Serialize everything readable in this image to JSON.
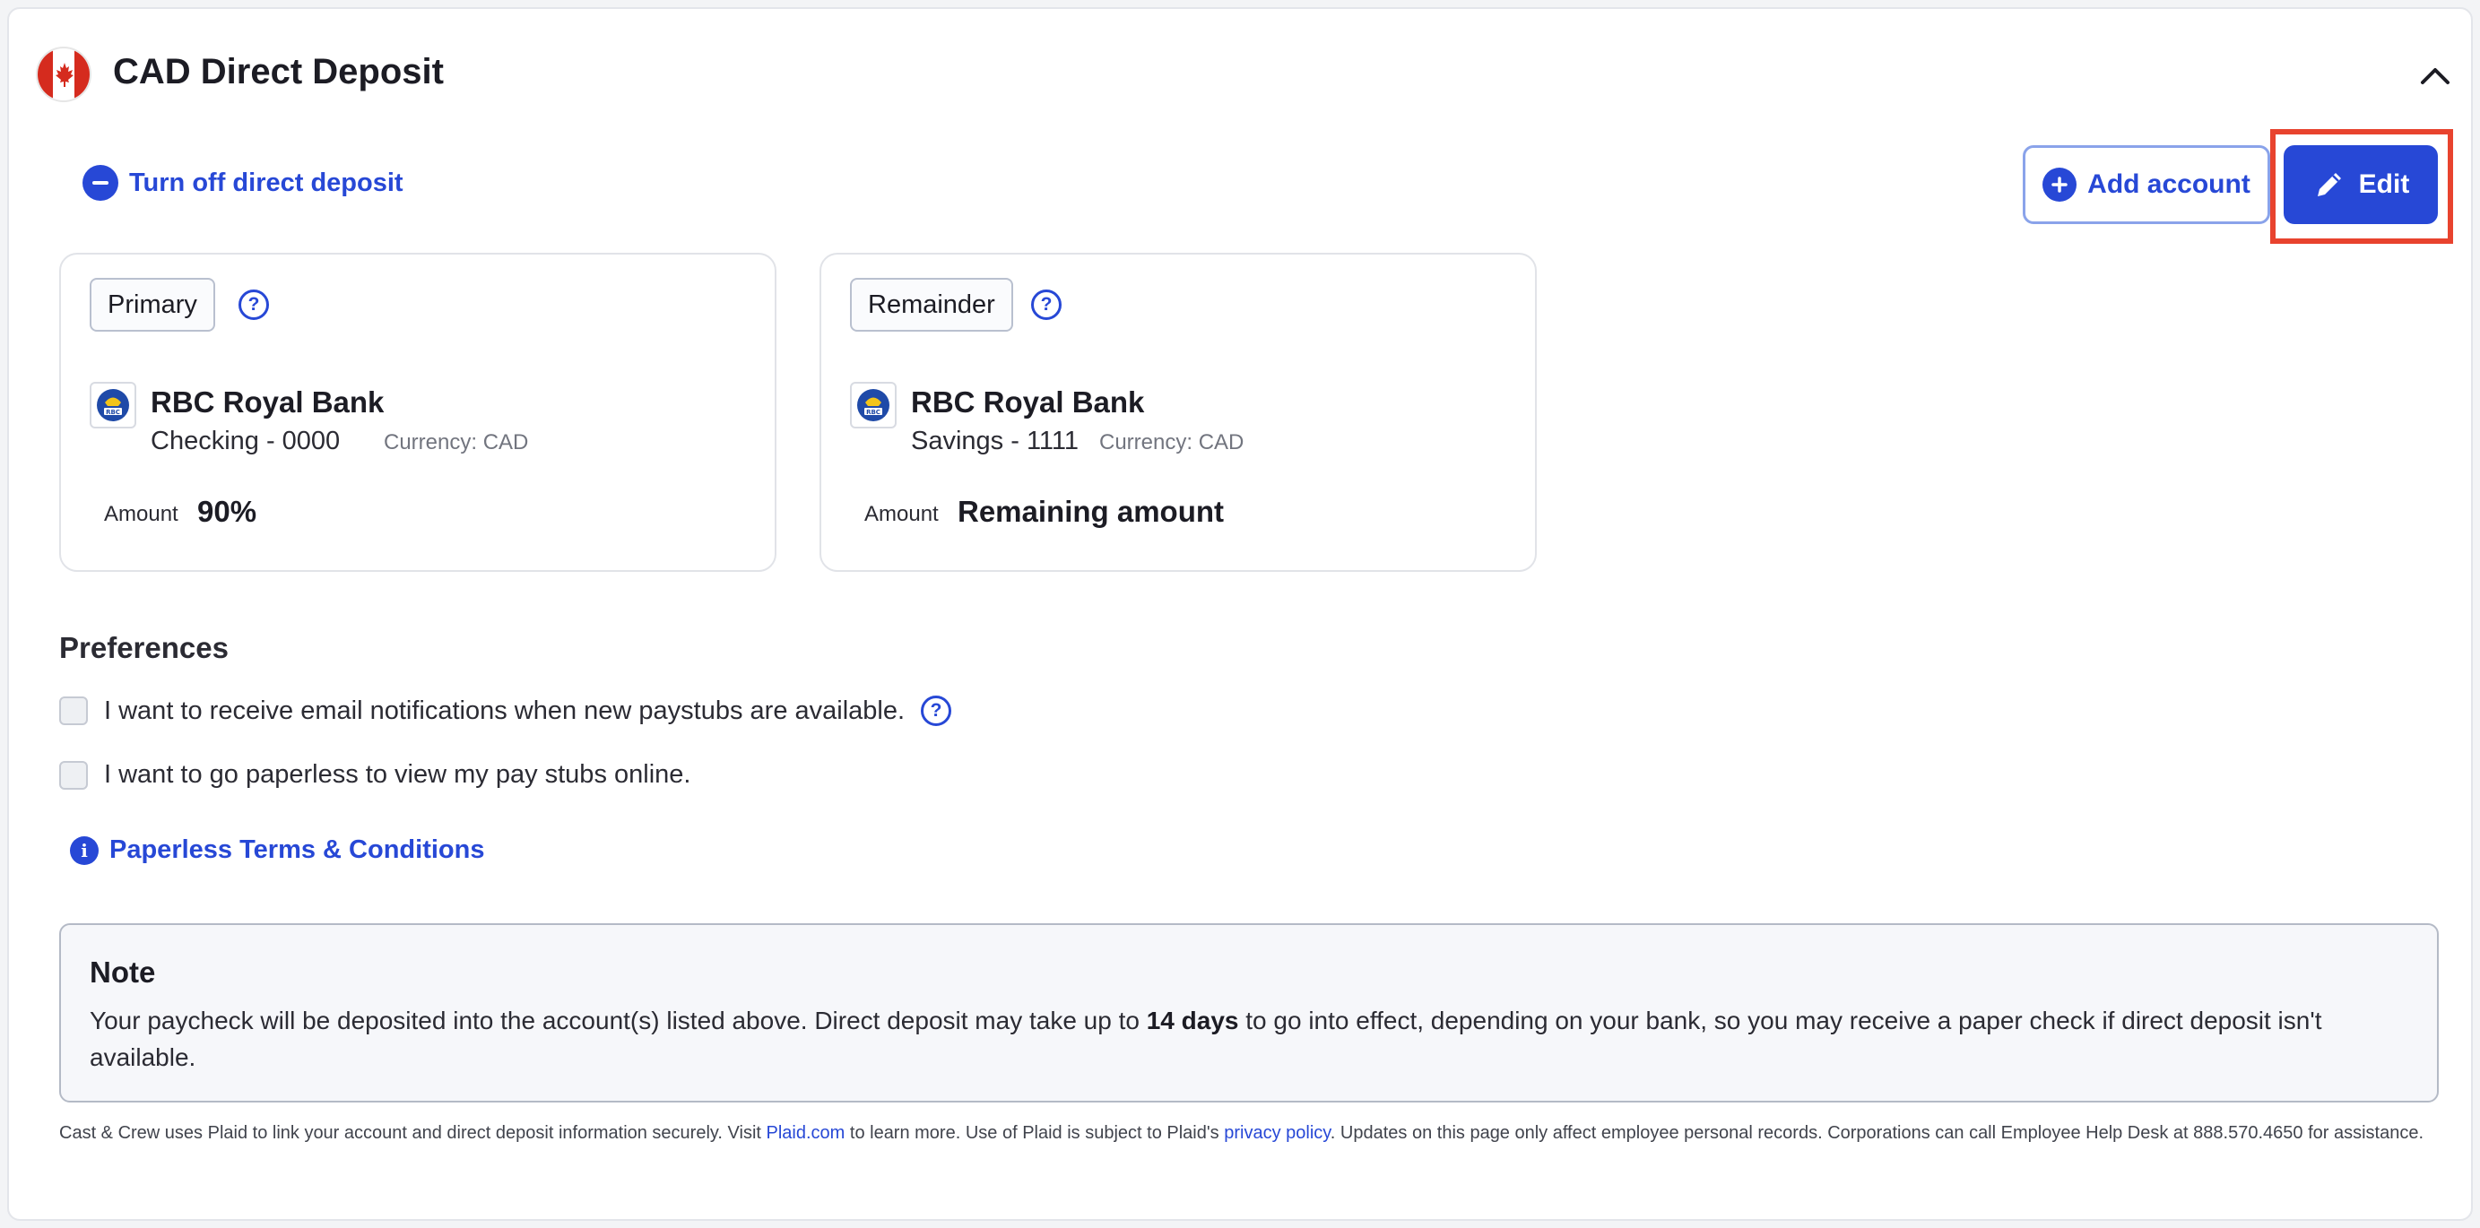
{
  "header": {
    "title": "CAD Direct Deposit",
    "flag_icon": "canada-flag-icon",
    "collapse_icon": "chevron-up-icon"
  },
  "actions": {
    "turn_off_label": "Turn off direct deposit",
    "add_account_label": "Add account",
    "edit_label": "Edit"
  },
  "accounts": [
    {
      "tag": "Primary",
      "bank_name": "RBC Royal Bank",
      "account": "Checking - 0000",
      "currency": "Currency: CAD",
      "amount_label": "Amount",
      "amount_value": "90%"
    },
    {
      "tag": "Remainder",
      "bank_name": "RBC Royal Bank",
      "account": "Savings - 1111",
      "currency": "Currency: CAD",
      "amount_label": "Amount",
      "amount_value": "Remaining amount"
    }
  ],
  "preferences": {
    "title": "Preferences",
    "email_notifications_label": "I want to receive email notifications when new paystubs are available.",
    "paperless_label": "I want to go paperless to view my pay stubs online.",
    "terms_label": "Paperless Terms & Conditions"
  },
  "note": {
    "title": "Note",
    "text_before": "Your paycheck will be deposited into the account(s) listed above. Direct deposit may take up to ",
    "text_bold": "14 days",
    "text_after": " to go into effect, depending on your bank, so you may receive a paper check if direct deposit isn't available."
  },
  "footer": {
    "part1": "Cast & Crew uses Plaid to link your account and direct deposit information securely. Visit ",
    "plaid_link": "Plaid.com",
    "part2": " to learn more. Use of Plaid is subject to Plaid's ",
    "privacy_link": "privacy policy",
    "part3": ". Updates on this page only affect employee personal records. Corporations can call Employee Help Desk at 888.570.4650 for assistance."
  },
  "colors": {
    "accent": "#2748d6",
    "highlight": "#e8432e"
  }
}
